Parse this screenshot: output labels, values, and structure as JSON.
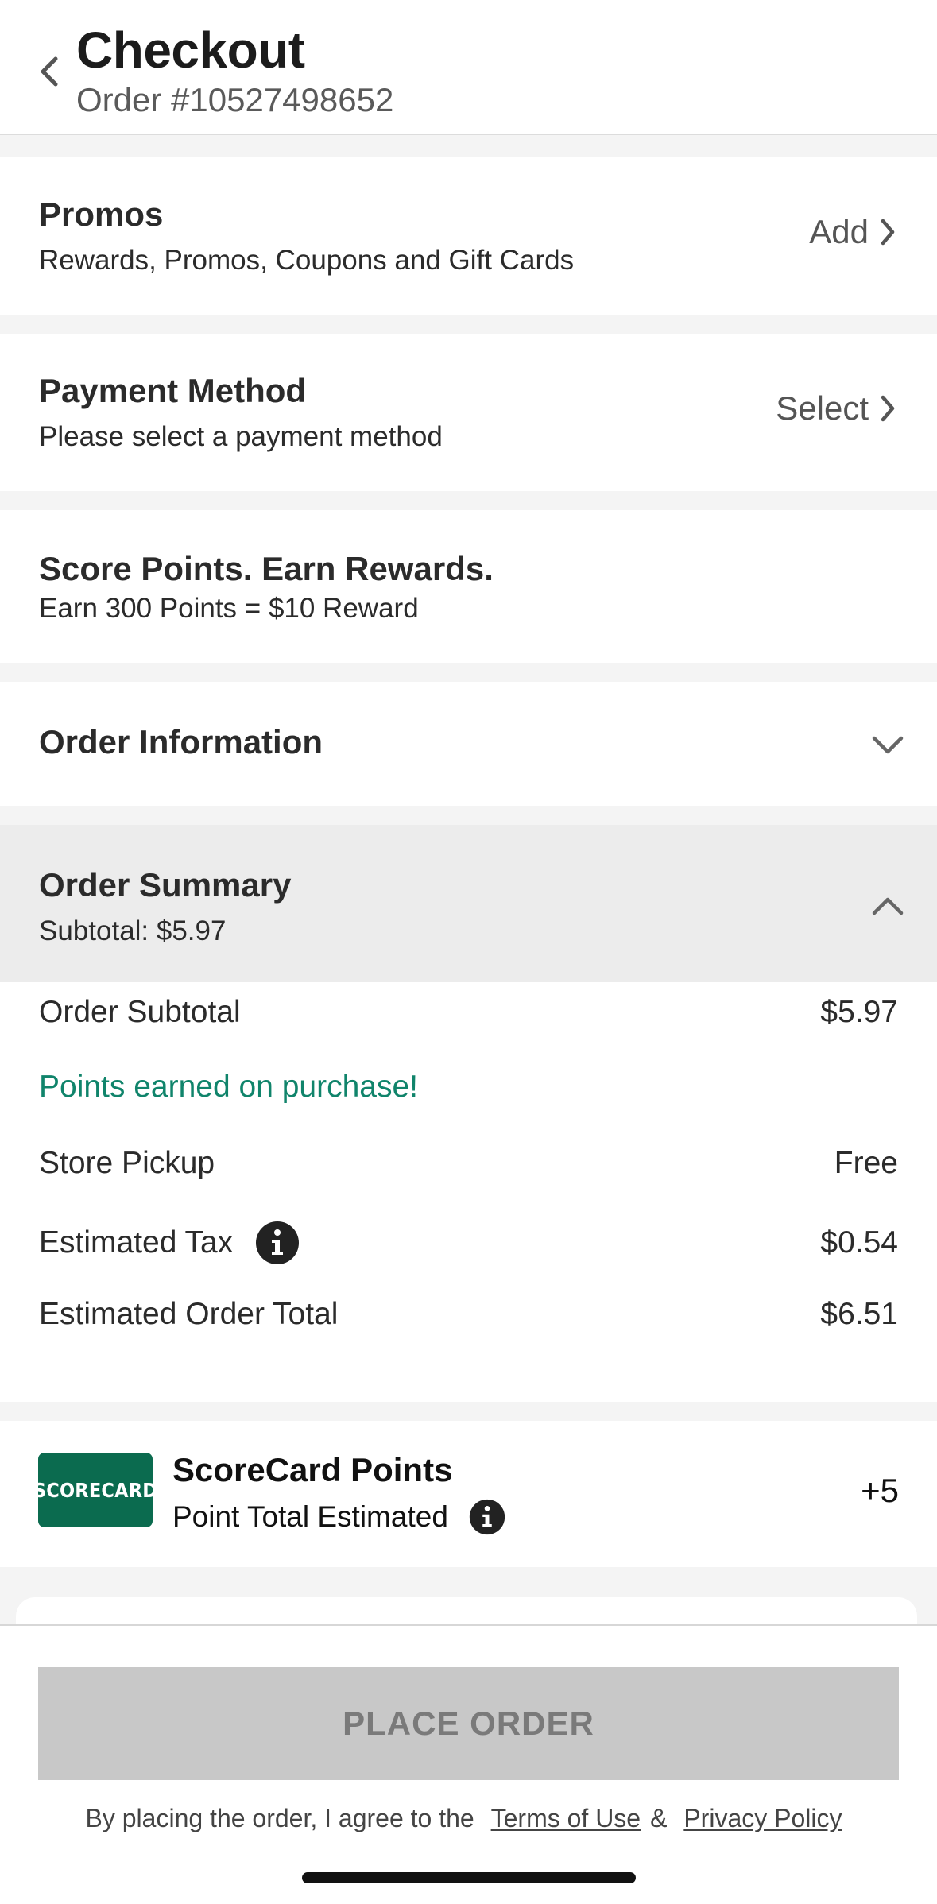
{
  "header": {
    "title": "Checkout",
    "order_number": "Order #10527498652"
  },
  "promos": {
    "title": "Promos",
    "subtitle": "Rewards, Promos, Coupons and Gift Cards",
    "action": "Add"
  },
  "payment": {
    "title": "Payment Method",
    "subtitle": "Please select a payment method",
    "action": "Select"
  },
  "score": {
    "title": "Score Points. Earn Rewards.",
    "subtitle": "Earn 300 Points = $10 Reward"
  },
  "order_info": {
    "title": "Order Information"
  },
  "summary": {
    "title": "Order Summary",
    "subtitle": "Subtotal: $5.97",
    "rows": {
      "subtotal_label": "Order Subtotal",
      "subtotal_value": "$5.97",
      "points_note": "Points earned on purchase!",
      "pickup_label": "Store Pickup",
      "pickup_value": "Free",
      "tax_label": "Estimated Tax",
      "tax_value": "$0.54",
      "total_label": "Estimated Order Total",
      "total_value": "$6.51"
    }
  },
  "scorecard": {
    "logo_text": "SCORECARD",
    "title": "ScoreCard Points",
    "subtitle": "Point Total Estimated",
    "points": "+5"
  },
  "footer": {
    "button": "PLACE ORDER",
    "legal_prefix": "By placing the order, I agree to the",
    "terms": "Terms of Use",
    "ampersand": "&",
    "privacy": "Privacy Policy"
  },
  "colors": {
    "accent_green": "#10846b",
    "logo_green": "#0b6b4f",
    "button_disabled": "#c8c8c8"
  }
}
